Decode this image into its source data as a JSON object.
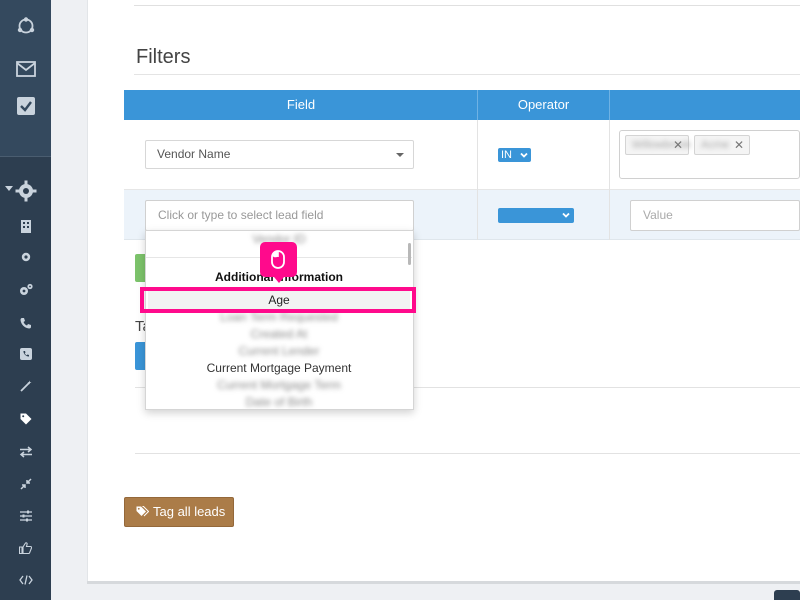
{
  "sidebar": {
    "top_icons": [
      "hub-icon",
      "mail-icon",
      "checkbox-icon"
    ],
    "icons": [
      "gear-icon",
      "building-icon",
      "small-gear-icon",
      "gears-icon",
      "phone-icon",
      "phone-box-icon",
      "wand-icon",
      "tag-icon",
      "transfer-icon",
      "compress-icon",
      "sliders-icon",
      "thumbs-up-icon",
      "code-icon"
    ]
  },
  "page": {
    "section_title": "Filters",
    "partial_text": "Ta"
  },
  "table": {
    "headers": [
      "Field",
      "Operator",
      ""
    ],
    "row1": {
      "field": "Vendor Name",
      "operator": "IN",
      "tags": [
        "Willowbrook",
        "Acme"
      ]
    },
    "row2": {
      "field_placeholder": "Click or type to select lead field",
      "value_placeholder": "Value"
    }
  },
  "dropdown": {
    "top_blurred": "Vendor ID",
    "group_label": "Additional Information",
    "selected": "Age",
    "blurred_items": [
      "Loan Term Requested",
      "Created At",
      "Current Lender"
    ],
    "partial_item": "Current Mortgage Payment",
    "more_blurred": [
      "Current Mortgage Term",
      "Date of Birth"
    ]
  },
  "actions": {
    "tag_all_label": "Tag all leads"
  },
  "colors": {
    "sidebar_bg": "#2d3e50",
    "header_blue": "#3a95d8",
    "highlight": "#ff0a8c",
    "tag_button": "#ab7c48"
  }
}
